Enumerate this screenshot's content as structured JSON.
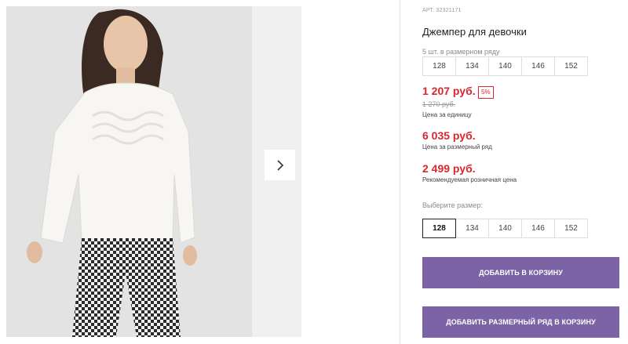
{
  "product": {
    "article": "АРТ. 32321171",
    "title": "Джемпер для девочки"
  },
  "series": {
    "label": "5 шт. в размерном ряду",
    "sizes": [
      "128",
      "134",
      "140",
      "146",
      "152"
    ]
  },
  "prices": {
    "unit_price": "1 207 руб.",
    "discount_badge": "5%",
    "old_price": "1 270 руб.",
    "unit_caption": "Цена за единицу",
    "series_price": "6 035 руб.",
    "series_caption": "Цена за размерный ряд",
    "retail_price": "2 499 руб.",
    "retail_caption": "Рекомендуемая розничная цена"
  },
  "size_select": {
    "label": "Выберите размер:",
    "options": [
      "128",
      "134",
      "140",
      "146",
      "152"
    ],
    "selected": "128"
  },
  "actions": {
    "add_to_cart": "ДОБАВИТЬ В КОРЗИНУ",
    "add_series_to_cart": "ДОБАВИТЬ РАЗМЕРНЫЙ РЯД В КОРЗИНУ"
  },
  "gallery": {
    "next_icon": "chevron-right-icon"
  },
  "colors": {
    "price_red": "#d9262f",
    "button_purple": "#7b63a5"
  }
}
